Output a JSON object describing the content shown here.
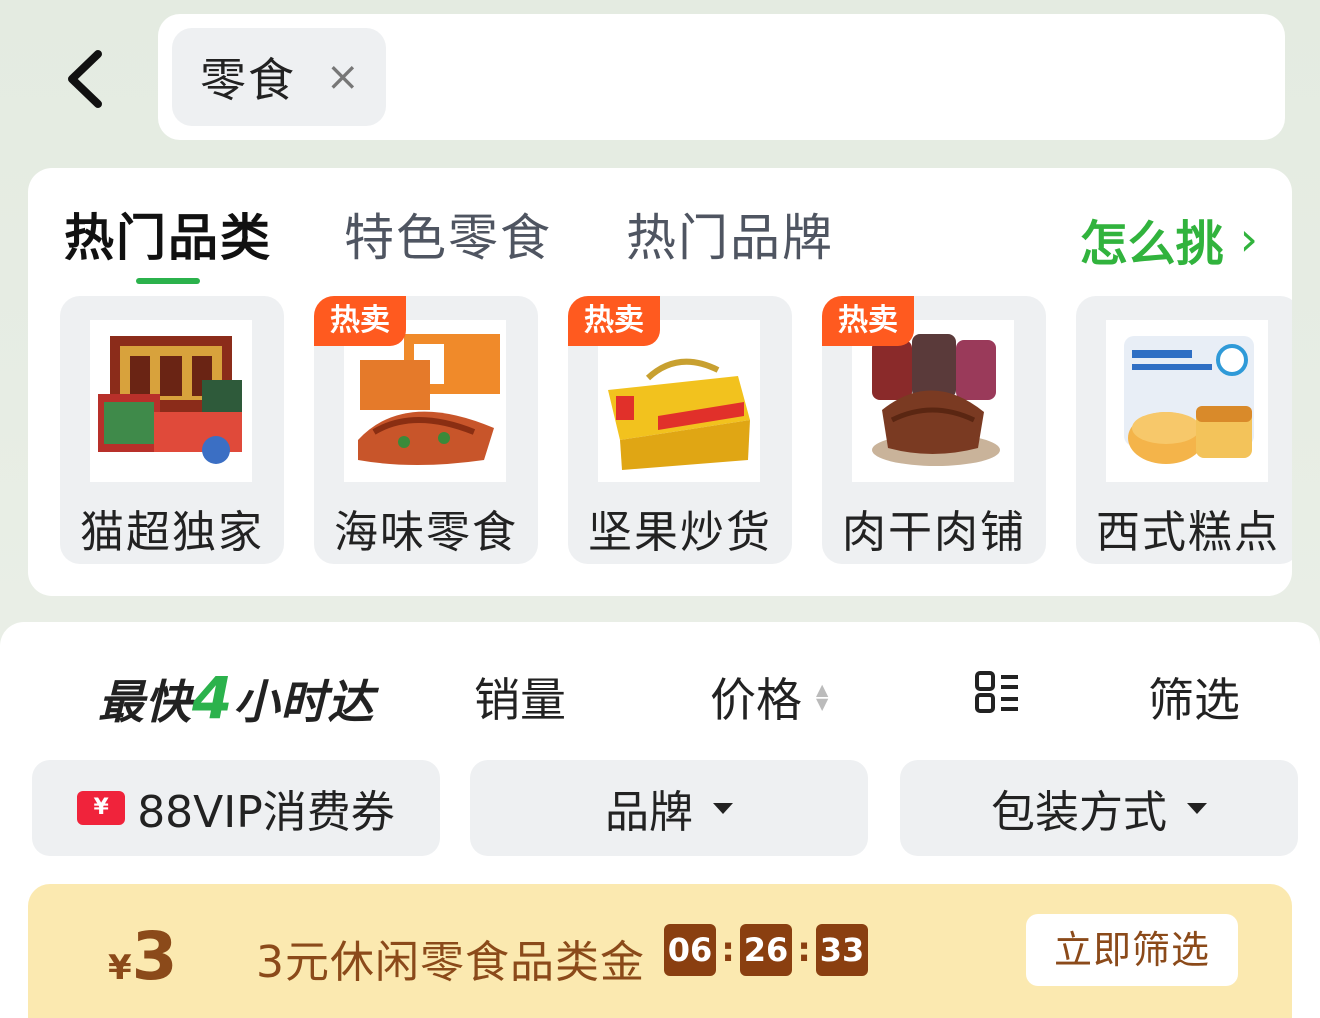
{
  "header": {
    "search_chip": "零食",
    "chip_close": "×"
  },
  "categories": {
    "tabs": [
      {
        "label": "热门品类",
        "active": true
      },
      {
        "label": "特色零食",
        "active": false
      },
      {
        "label": "热门品牌",
        "active": false
      }
    ],
    "how_to_pick": "怎么挑",
    "how_to_pick_icon": "chevron-right-icon",
    "items": [
      {
        "label": "猫超独家",
        "badge": ""
      },
      {
        "label": "海味零食",
        "badge": "热卖"
      },
      {
        "label": "坚果炒货",
        "badge": "热卖"
      },
      {
        "label": "肉干肉铺",
        "badge": "热卖"
      },
      {
        "label": "西式糕点",
        "badge": ""
      }
    ]
  },
  "sort": {
    "fast_prefix": "最快",
    "fast_num": "4",
    "fast_suffix": "小时达",
    "sales": "销量",
    "price": "价格",
    "filter": "筛选"
  },
  "chips": {
    "vip": "88VIP消费券",
    "vip_icon_text": "¥",
    "brand": "品牌",
    "pack": "包装方式"
  },
  "promo": {
    "currency": "¥",
    "amount": "3",
    "text": "3元休闲零食品类金",
    "timer": [
      "06",
      "26",
      "33"
    ],
    "button": "立即筛选"
  },
  "colors": {
    "accent_green": "#2bb24c",
    "hot_badge": "#ff5a1f",
    "promo_bg": "#fbe9b0",
    "promo_text": "#8b4a1a"
  }
}
